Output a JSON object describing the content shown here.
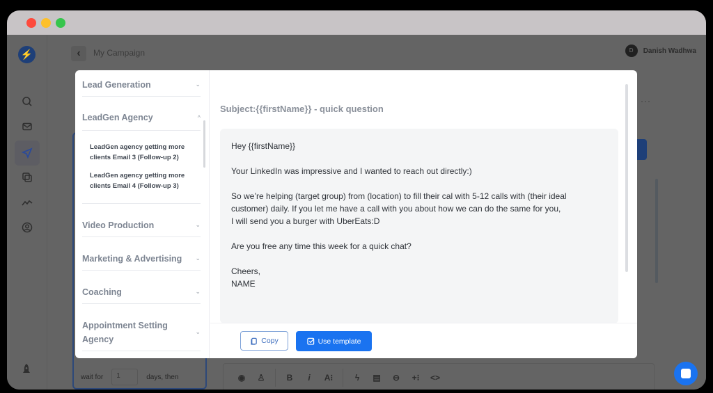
{
  "window": {
    "controls": [
      "close",
      "minimize",
      "maximize"
    ]
  },
  "app": {
    "logo_icon": "bolt-icon",
    "breadcrumb": "My Campaign",
    "back_icon": "chevron-left-icon",
    "user": {
      "initial": "D",
      "name": "Danish Wadhwa"
    },
    "more_label": "···",
    "sidebar": [
      {
        "icon": "search-icon",
        "active": false
      },
      {
        "icon": "mail-icon",
        "active": false
      },
      {
        "icon": "send-icon",
        "active": true
      },
      {
        "icon": "copy-icon",
        "active": false
      },
      {
        "icon": "analytics-icon",
        "active": false
      },
      {
        "icon": "profile-icon",
        "active": false
      }
    ],
    "bottom_icon": "rocket-icon",
    "step": {
      "wait_label": "wait for",
      "wait_value": "1",
      "days_label": "days, then"
    },
    "editor_toolbar": [
      "clock-icon",
      "stamp-icon",
      "bold-icon",
      "italic-icon",
      "font-size-icon",
      "bolt-icon",
      "template-icon",
      "link-icon",
      "insert-variable-icon",
      "code-icon"
    ],
    "editor_toolbar_glyphs": [
      "◉",
      "♙",
      "B",
      "i",
      "A⁝",
      "ϟ",
      "▤",
      "⊖",
      "+⁝",
      "<>"
    ],
    "chat_icon": "chat-icon"
  },
  "modal": {
    "categories": [
      {
        "label": "Lead Generation",
        "expanded": false,
        "chevron": "⌄"
      },
      {
        "label": "LeadGen Agency",
        "expanded": true,
        "chevron": "^"
      },
      {
        "label": "Video Production",
        "expanded": false,
        "chevron": "⌄"
      },
      {
        "label": "Marketing & Advertising",
        "expanded": false,
        "chevron": "⌄"
      },
      {
        "label": "Coaching",
        "expanded": false,
        "chevron": "⌄"
      },
      {
        "label": "Appointment Setting Agency",
        "expanded": false,
        "chevron": "⌄"
      }
    ],
    "templates": [
      "LeadGen agency getting more clients Email 3 (Follow-up 2)",
      "LeadGen agency getting more clients Email 4 (Follow-up 3)"
    ],
    "subject": "Subject:{{firstName}} - quick question",
    "body_lines": [
      "Hey {{firstName}}",
      "",
      "Your LinkedIn was impressive and I wanted to reach out directly:)",
      "",
      "So we’re helping (target group) from (location) to fill their cal with 5-12 calls with (their ideal",
      "customer) daily. If you let me have a call with you about how we can do the same for you,",
      "I will send you a burger with UberEats:D",
      "",
      "Are you free any time this week for a quick chat?",
      "",
      "Cheers,",
      "NAME"
    ],
    "copy_label": "Copy",
    "use_template_label": "Use template",
    "accent": "#1a73f0"
  }
}
